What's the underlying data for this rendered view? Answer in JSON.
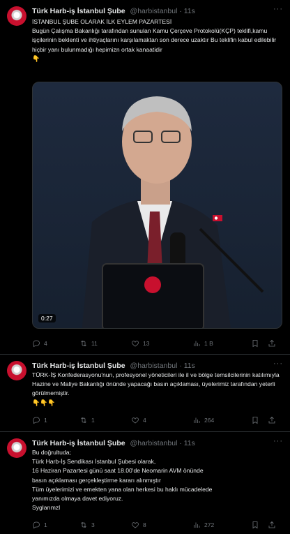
{
  "tweets": [
    {
      "name": "Türk Harb-iş İstanbul Şube",
      "handle": "@harbistanbul",
      "time": "11s",
      "lines": [
        "İSTANBUL ŞUBE OLARAK İLK EYLEM PAZARTESİ",
        "Bugün Çalışma Bakanlığı tarafından sunulan Kamu Çerçeve Protokolü(KÇP) teklifi,kamu işçilerinin beklenti ve ihtiyaçlarını karşılamaktan son derece uzaktır Bu teklifin kabul edilebilir hiçbir yanı bulunmadığı hepimizn ortak kanaatidir",
        "👇"
      ],
      "video": {
        "duration": "0:27"
      },
      "stats": {
        "replies": "4",
        "reposts": "11",
        "likes": "13",
        "views": "1 B"
      }
    },
    {
      "name": "Türk Harb-iş İstanbul Şube",
      "handle": "@harbistanbul",
      "time": "11s",
      "lines": [
        "TÜRK-İŞ Konfederasyonu'nun, profesyonel yöneticileri ile il ve bölge temsilcilerinin katılımıyla Hazine ve Maliye Bakanlığı önünde yapacağı basın açıklaması, üyelerimiz tarafından yeterli görülmemiştir.",
        "👇👇👇"
      ],
      "stats": {
        "replies": "1",
        "reposts": "1",
        "likes": "4",
        "views": "264"
      }
    },
    {
      "name": "Türk Harb-iş İstanbul Şube",
      "handle": "@harbistanbul",
      "time": "11s",
      "lines": [
        "Bu doğrultuda;",
        "Türk Harb-İş Sendikası İstanbul Şubesi olarak,",
        "16 Haziran Pazartesi günü saat 18.00'de Neomarin AVM önünde",
        "basın açıklaması gerçekleştirme kararı alınmıştır",
        "Tüm üyelerimizi ve emekten yana olan herkesi bu haklı mücadelede",
        "yanımızda olmaya davet ediyoruz.",
        "Syglarımzl"
      ],
      "stats": {
        "replies": "1",
        "reposts": "3",
        "likes": "8",
        "views": "272"
      }
    }
  ],
  "icons": {
    "reply": "reply-icon",
    "repost": "repost-icon",
    "like": "heart-icon",
    "views": "views-icon",
    "bookmark": "bookmark-icon",
    "share": "share-icon"
  }
}
